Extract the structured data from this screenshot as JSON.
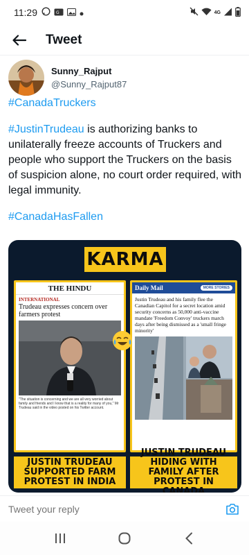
{
  "status_bar": {
    "time": "11:29",
    "icons": [
      "whatsapp-icon",
      "gallery-icon",
      "dot-icon"
    ],
    "right_icons": [
      "mute-icon",
      "wifi-icon",
      "4g-icon",
      "signal-icon",
      "battery-icon"
    ],
    "network": "4G"
  },
  "header": {
    "title": "Tweet"
  },
  "author": {
    "display_name": "Sunny_Rajput",
    "handle": "@Sunny_Rajput87"
  },
  "tweet": {
    "hashtag_1": "#CanadaTruckers",
    "hashtag_2": "#JustinTrudeau",
    "body": " is authorizing banks to unilaterally freeze accounts of Truckers and people who support the Truckers on the basis of suspicion alone, no court order required, with legal immunity.",
    "hashtag_3": "#CanadaHasFallen"
  },
  "media": {
    "banner": "KARMA",
    "left_paper": {
      "name": "THE HINDU",
      "section": "INTERNATIONAL",
      "headline": "Trudeau expresses concern over farmers protest",
      "caption": "\"The situation is concerning and we are all very worried about family and friends and I know that is a reality for many of you,\" Mr Trudeau said in the video posted on his Twitter account."
    },
    "right_paper": {
      "name": "Daily Mail",
      "more": "MORE STORIES",
      "text": "Justin Trudeau and his family flee the Canadian Capitol for a secret location amid security concerns as 50,000 anti-vaccine mandate 'Freedom Convoy' truckers march days after being dismissed as a 'small fringe minority'"
    },
    "left_caption": "JUSTIN TRUDEAU SUPPORTED FARM PROTEST IN INDIA",
    "right_caption": "JUSTIN TRUDEAU HIDING WITH FAMILY AFTER PROTEST IN CANADA",
    "emoji": "laughing-with-tears-emoji"
  },
  "reply": {
    "placeholder": "Tweet your reply"
  },
  "nav": {
    "items": [
      "recent-apps",
      "home",
      "back"
    ]
  },
  "colors": {
    "accent": "#1d9bf0",
    "banner_yellow": "#f7c51b",
    "media_bg": "#0b1a2d"
  }
}
